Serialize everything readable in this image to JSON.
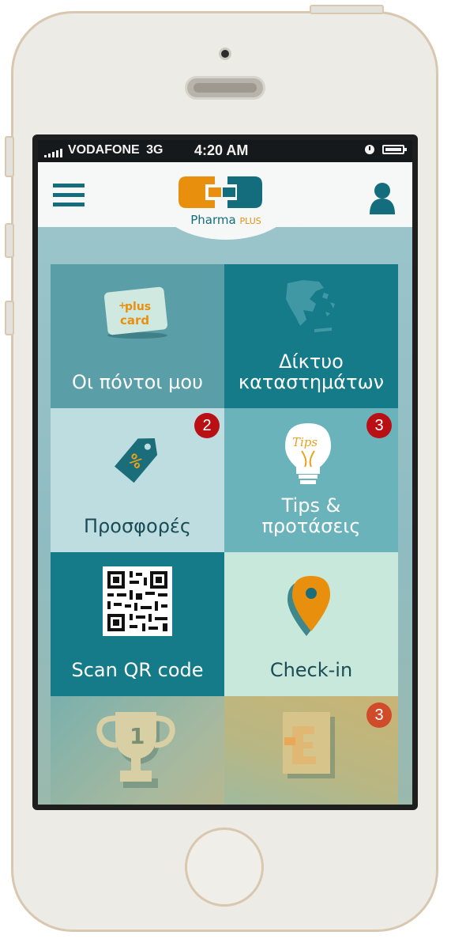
{
  "status_bar": {
    "carrier": "VODAFONE",
    "network": "3G",
    "time": "4:20 AM"
  },
  "header": {
    "logo_brand": "Pharma",
    "logo_suffix": "PLUS",
    "menu_icon": "hamburger-menu-icon",
    "profile_icon": "user-profile-icon"
  },
  "tiles": [
    {
      "label_lines": [
        "Οι πόντοι μου"
      ],
      "icon": "plus-card-icon",
      "card_text_1": "plus",
      "card_text_2": "card"
    },
    {
      "label_lines": [
        "Δίκτυο",
        "καταστημάτων"
      ],
      "icon": "greece-map-icon"
    },
    {
      "label_lines": [
        "Προσφορές"
      ],
      "icon": "discount-tag-icon",
      "tag_text": "%",
      "badge": "2"
    },
    {
      "label_lines": [
        "Tips &",
        "προτάσεις"
      ],
      "icon": "lightbulb-tips-icon",
      "bulb_text": "Tips",
      "badge": "3"
    },
    {
      "label_lines": [
        "Scan QR code"
      ],
      "icon": "qr-code-icon"
    },
    {
      "label_lines": [
        "Check-in"
      ],
      "icon": "location-pin-icon"
    },
    {
      "label_lines": [],
      "icon": "trophy-icon",
      "trophy_text": "1"
    },
    {
      "label_lines": [],
      "icon": "booklet-icon",
      "badge": "3"
    }
  ],
  "colors": {
    "brand_teal": "#136d7c",
    "brand_orange": "#e8900e",
    "badge_red": "#b91016"
  }
}
